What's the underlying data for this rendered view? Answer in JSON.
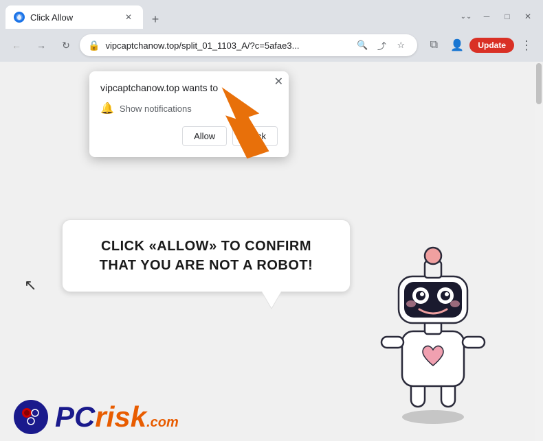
{
  "browser": {
    "tab": {
      "title": "Click Allow",
      "favicon_color": "#1a73e8"
    },
    "window_controls": {
      "minimize": "─",
      "maximize": "□",
      "close": "✕"
    },
    "url": "vipcaptchanow.top/split_01_1103_A/?c=5afae3...",
    "update_button": "Update"
  },
  "notification_popup": {
    "site": "vipcaptchanow.top wants to",
    "notification_label": "Show notifications",
    "allow_btn": "Allow",
    "block_btn": "Block"
  },
  "speech_bubble": {
    "text": "CLICK «ALLOW» TO CONFIRM THAT YOU ARE NOT A ROBOT!"
  },
  "pcrisk": {
    "text_pc": "PC",
    "text_risk": "risk",
    "text_dotcom": ".com"
  },
  "colors": {
    "arrow_orange": "#e8700a",
    "browser_chrome": "#dee1e6",
    "text_dark": "#1a1a1a",
    "update_red": "#d93025"
  }
}
